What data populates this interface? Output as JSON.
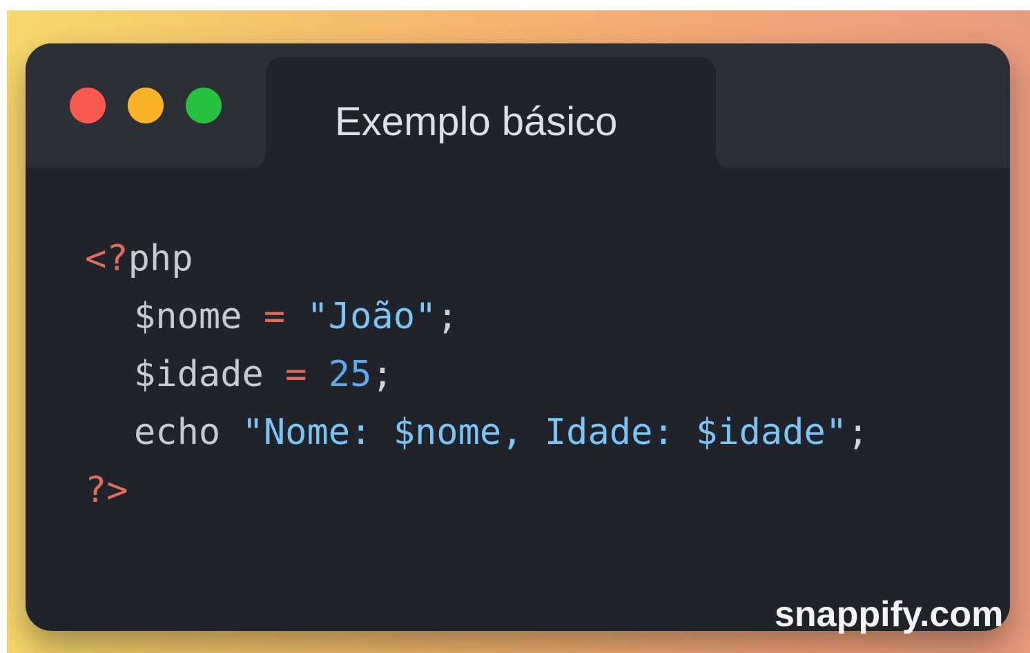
{
  "window": {
    "title": "Exemplo básico",
    "controls": {
      "close_color": "#f95a50",
      "minimize_color": "#fbb428",
      "maximize_color": "#26c13e"
    }
  },
  "code": {
    "language": "php",
    "line1": {
      "open_tag": "<?",
      "keyword": "php"
    },
    "line2": {
      "variable": "$nome",
      "operator": "=",
      "string": "\"João\"",
      "terminator": ";"
    },
    "line3": {
      "variable": "$idade",
      "operator": "=",
      "number": "25",
      "terminator": ";"
    },
    "line4": {
      "keyword": "echo",
      "string": "\"Nome: $nome, Idade: $idade\"",
      "terminator": ";"
    },
    "line5": {
      "close_tag": "?>"
    }
  },
  "watermark": "snappify.com",
  "colors": {
    "background_gradient": [
      "#f6d96c",
      "#f5b66e",
      "#f4a57a",
      "#e99b7e"
    ],
    "window_bg": "#20232a",
    "titlebar_bg": "#2c2f35",
    "tag": "#e06c5c",
    "string": "#7cc4f5",
    "number": "#5ea8ee",
    "text": "#c7cad0"
  }
}
